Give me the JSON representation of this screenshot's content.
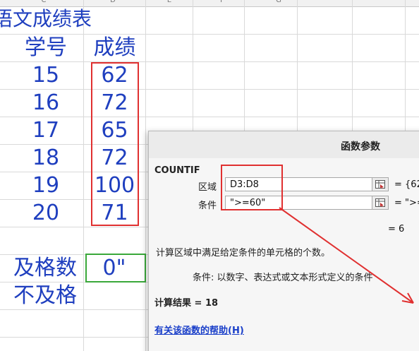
{
  "columns": [
    "C",
    "D",
    "E",
    "F",
    "G"
  ],
  "sheet": {
    "title": "语文成绩表",
    "header_id": "学号",
    "header_score": "成绩",
    "rows": [
      {
        "id": "15",
        "score": "62"
      },
      {
        "id": "16",
        "score": "72"
      },
      {
        "id": "17",
        "score": "65"
      },
      {
        "id": "18",
        "score": "72"
      },
      {
        "id": "19",
        "score": "100"
      },
      {
        "id": "20",
        "score": "71"
      }
    ],
    "pass_label": "及格数",
    "pass_value": "0\"",
    "fail_label": "不及格"
  },
  "dialog": {
    "title": "函数参数",
    "function_name": "COUNTIF",
    "args": [
      {
        "label": "区域",
        "value": "D3:D8",
        "result": "= {62"
      },
      {
        "label": "条件",
        "value": "\">=60\"",
        "result": "= \">="
      }
    ],
    "eq_result": "= 6",
    "description": "计算区域中满足给定条件的单元格的个数。",
    "arg_description": "条件:  以数字、表达式或文本形式定义的条件",
    "calc_result": "计算结果 =  18",
    "help_link": "有关该函数的帮助(H)"
  },
  "colors": {
    "cell_text": "#1f3fbf",
    "highlight": "#e03030",
    "active_cell": "#3aa83a",
    "link": "#1a3fc9"
  }
}
